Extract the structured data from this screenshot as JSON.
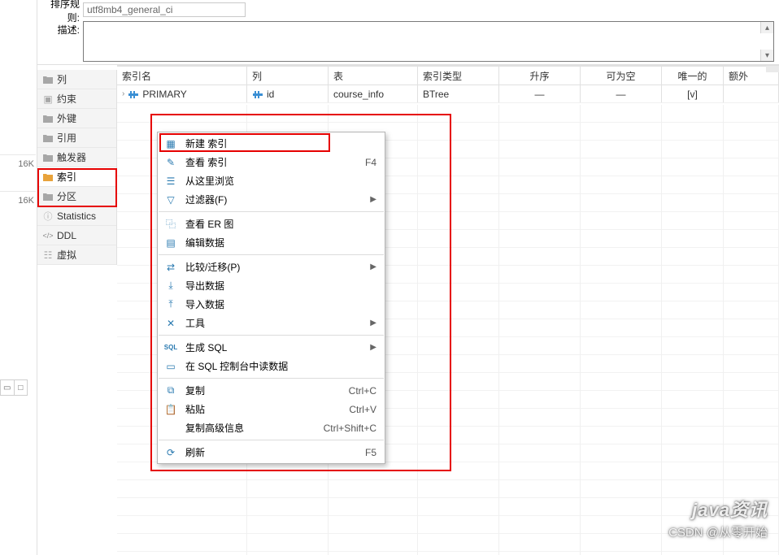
{
  "top": {
    "rule_label": "排序规则:",
    "rule_value": "utf8mb4_general_ci",
    "desc_label": "描述:"
  },
  "sidebar": {
    "items": [
      {
        "label": "列",
        "icon": "folder"
      },
      {
        "label": "约束",
        "icon": "box"
      },
      {
        "label": "外键",
        "icon": "folder"
      },
      {
        "label": "引用",
        "icon": "folder"
      },
      {
        "label": "触发器",
        "icon": "folder"
      },
      {
        "label": "索引",
        "icon": "folder-sel"
      },
      {
        "label": "分区",
        "icon": "folder"
      },
      {
        "label": "Statistics",
        "icon": "info"
      },
      {
        "label": "DDL",
        "icon": "code"
      },
      {
        "label": "虚拟",
        "icon": "virtual"
      }
    ]
  },
  "gutter": {
    "m1": "16K",
    "m2": "16K"
  },
  "table": {
    "headers": {
      "name": "索引名",
      "column": "列",
      "table": "表",
      "type": "索引类型",
      "asc": "升序",
      "nullable": "可为空",
      "unique": "唯一的",
      "extra": "额外"
    },
    "rows": [
      {
        "name": "PRIMARY",
        "column": "id",
        "table": "course_info",
        "type": "BTree",
        "asc": "—",
        "nullable": "—",
        "unique": "[v]"
      }
    ]
  },
  "menu": {
    "groups": [
      [
        {
          "label": "新建 索引",
          "short": "",
          "arrow": false,
          "icon": "new"
        },
        {
          "label": "查看 索引",
          "short": "F4",
          "arrow": false,
          "icon": "view"
        },
        {
          "label": "从这里浏览",
          "short": "",
          "arrow": false,
          "icon": "browse"
        },
        {
          "label": "过滤器(F)",
          "short": "",
          "arrow": true,
          "icon": "filter"
        }
      ],
      [
        {
          "label": "查看 ER 图",
          "short": "",
          "arrow": false,
          "icon": "er"
        },
        {
          "label": "编辑数据",
          "short": "",
          "arrow": false,
          "icon": "edit"
        }
      ],
      [
        {
          "label": "比较/迁移(P)",
          "short": "",
          "arrow": true,
          "icon": "compare"
        },
        {
          "label": "导出数据",
          "short": "",
          "arrow": false,
          "icon": "export"
        },
        {
          "label": "导入数据",
          "short": "",
          "arrow": false,
          "icon": "import"
        },
        {
          "label": "工具",
          "short": "",
          "arrow": true,
          "icon": "tools"
        }
      ],
      [
        {
          "label": "生成 SQL",
          "short": "",
          "arrow": true,
          "icon": "sql"
        },
        {
          "label": "在 SQL 控制台中读数据",
          "short": "",
          "arrow": false,
          "icon": "console"
        }
      ],
      [
        {
          "label": "复制",
          "short": "Ctrl+C",
          "arrow": false,
          "icon": "copy"
        },
        {
          "label": "粘贴",
          "short": "Ctrl+V",
          "arrow": false,
          "icon": "paste"
        },
        {
          "label": "复制高级信息",
          "short": "Ctrl+Shift+C",
          "arrow": false,
          "icon": ""
        }
      ],
      [
        {
          "label": "刷新",
          "short": "F5",
          "arrow": false,
          "icon": "refresh"
        }
      ]
    ]
  },
  "watermark": {
    "line1": "java资讯",
    "line2": "CSDN @从零开始"
  }
}
